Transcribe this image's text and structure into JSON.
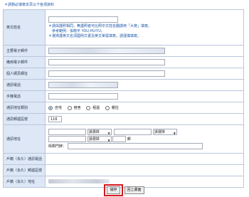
{
  "top_note": "＊請務必填寫本頁以下各項資料",
  "rows": {
    "english_name": {
      "label": "英文姓名",
      "notes": [
        "＊請與護照相同，無護照者可比照中文姓名翻譯用「大寫」填寫。",
        "　參考範例：張曉平 YOU,HU-YU。",
        "＊選擇護英文名須國例文書及英文單需填寫，請謹慎填寫。"
      ]
    },
    "main_email": {
      "label": "主要電子郵件"
    },
    "backup_email": {
      "label": "備用電子郵件"
    },
    "personal_site": {
      "label": "個人網頁網址"
    },
    "contact_phone": {
      "label": "通訊電話"
    },
    "mobile": {
      "label": "手機電話"
    },
    "address_type": {
      "label": "通訊地址類別",
      "options": [
        {
          "label": "自宅",
          "selected": true
        },
        {
          "label": "宿舍",
          "selected": false
        },
        {
          "label": "租屋",
          "selected": false
        },
        {
          "label": "親住",
          "selected": false
        }
      ]
    },
    "postal_code": {
      "label": "通訊郵遞區號",
      "value": "116"
    },
    "address": {
      "label": "通訊地址",
      "select_placeholder": "請選擇",
      "postal_suffix": "郵",
      "hint_label": "街鄰門牌："
    },
    "household_phone": {
      "label": "戶籍（永久）通訊電話"
    },
    "household_postal": {
      "label": "戶籍（永久）郵遞區號"
    },
    "household_address": {
      "label": "戶籍（永久）地址"
    }
  },
  "buttons": {
    "submit": "儲存",
    "back": "回上畫面"
  }
}
